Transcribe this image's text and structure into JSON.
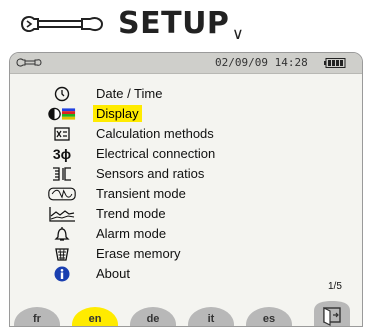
{
  "header": {
    "title": "SETUP",
    "chevron": "∨"
  },
  "status": {
    "datetime": "02/09/09 14:28"
  },
  "menu": {
    "items": [
      {
        "label": "Date / Time",
        "icon": "clock-icon",
        "selected": false
      },
      {
        "label": "Display",
        "icon": "display-contrast-icon",
        "selected": true
      },
      {
        "label": "Calculation methods",
        "icon": "calculation-icon",
        "selected": false
      },
      {
        "label": "Electrical connection",
        "icon": "three-phase-icon",
        "glyph": "3ϕ",
        "selected": false
      },
      {
        "label": "Sensors and ratios",
        "icon": "sensor-icon",
        "selected": false
      },
      {
        "label": "Transient mode",
        "icon": "transient-icon",
        "selected": false
      },
      {
        "label": "Trend mode",
        "icon": "trend-icon",
        "selected": false
      },
      {
        "label": "Alarm mode",
        "icon": "bell-icon",
        "selected": false
      },
      {
        "label": "Erase memory",
        "icon": "trash-icon",
        "selected": false
      },
      {
        "label": "About",
        "icon": "info-icon",
        "selected": false
      }
    ]
  },
  "tabs": [
    {
      "label": "fr",
      "active": false
    },
    {
      "label": "en",
      "active": true
    },
    {
      "label": "de",
      "active": false
    },
    {
      "label": "it",
      "active": false
    },
    {
      "label": "es",
      "active": false
    }
  ],
  "pagination": {
    "label": "1/5"
  },
  "colors": {
    "highlight": "#ffeb00",
    "tab": "#b8b8b8",
    "info": "#1a3fb0"
  }
}
